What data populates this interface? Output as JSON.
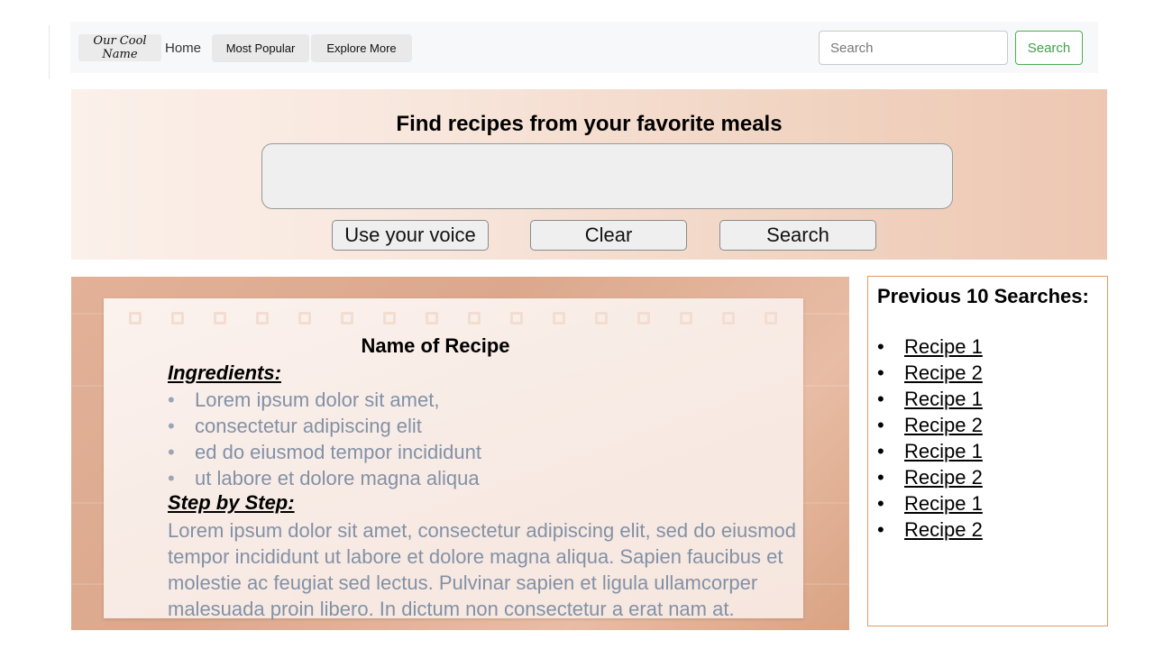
{
  "navbar": {
    "brand": "Our Cool Name",
    "links": [
      "Home",
      "Most Popular",
      "Explore More"
    ],
    "search_placeholder": "Search",
    "search_button": "Search"
  },
  "hero": {
    "title": "Find recipes from your favorite meals",
    "buttons": [
      "Use your voice",
      "Clear",
      "Search"
    ]
  },
  "recipe": {
    "name": "Name of Recipe",
    "ingredients_heading": "Ingredients:",
    "ingredients": [
      "Lorem ipsum dolor sit amet,",
      "consectetur adipiscing elit",
      "ed do eiusmod tempor incididunt",
      "ut labore et dolore magna aliqua"
    ],
    "steps_heading": "Step by Step:",
    "steps_text": "Lorem ipsum dolor sit amet, consectetur adipiscing elit, sed do eiusmod tempor incididunt ut labore et dolore magna aliqua. Sapien faucibus et molestie ac feugiat sed lectus. Pulvinar sapien et ligula ullamcorper malesuada proin libero. In dictum non consectetur a erat nam at."
  },
  "previous_searches": {
    "title": "Previous 10 Searches:",
    "items": [
      "Recipe 1",
      "Recipe 2",
      "Recipe 1",
      "Recipe 2",
      "Recipe 1",
      "Recipe 2",
      "Recipe 1",
      "Recipe 2"
    ]
  },
  "colors": {
    "accent_green": "#43a047",
    "panel_border": "#e19a62",
    "muted_text": "#8291a6"
  }
}
